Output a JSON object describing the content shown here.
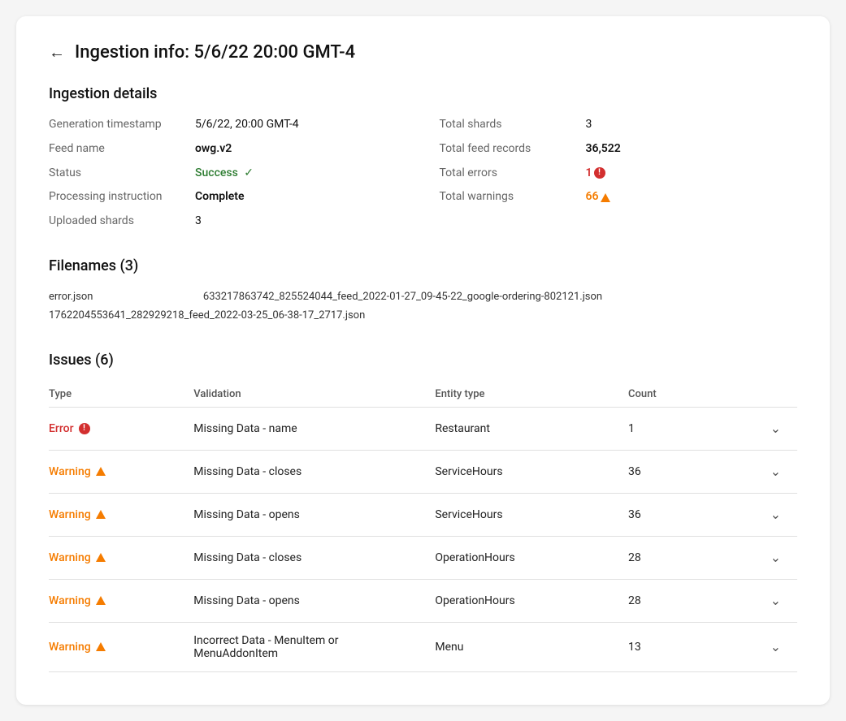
{
  "page": {
    "title": "Ingestion info: 5/6/22 20:00 GMT-4",
    "back_label": "←"
  },
  "ingestion_details": {
    "section_title": "Ingestion details",
    "fields": [
      {
        "label": "Generation timestamp",
        "value": "5/6/22, 20:00 GMT-4",
        "bold": false
      },
      {
        "label": "Feed name",
        "value": "owg.v2",
        "bold": true
      },
      {
        "label": "Status",
        "value": "Success",
        "type": "success"
      },
      {
        "label": "Processing instruction",
        "value": "Complete",
        "bold": true
      },
      {
        "label": "Uploaded shards",
        "value": "3",
        "bold": false
      }
    ],
    "right_fields": [
      {
        "label": "Total shards",
        "value": "3",
        "bold": false
      },
      {
        "label": "Total feed records",
        "value": "36,522",
        "bold": true
      },
      {
        "label": "Total errors",
        "value": "1",
        "type": "error"
      },
      {
        "label": "Total warnings",
        "value": "66",
        "type": "warning"
      }
    ]
  },
  "filenames": {
    "section_title": "Filenames (3)",
    "files": [
      "error.json",
      "633217863742_825524044_feed_2022-01-27_09-45-22_google-ordering-802121.json",
      "1762204553641_282929218_feed_2022-03-25_06-38-17_2717.json"
    ]
  },
  "issues": {
    "section_title": "Issues (6)",
    "columns": [
      "Type",
      "Validation",
      "Entity type",
      "Count"
    ],
    "rows": [
      {
        "type": "Error",
        "type_kind": "error",
        "validation": "Missing Data - name",
        "entity_type": "Restaurant",
        "count": "1"
      },
      {
        "type": "Warning",
        "type_kind": "warning",
        "validation": "Missing Data - closes",
        "entity_type": "ServiceHours",
        "count": "36"
      },
      {
        "type": "Warning",
        "type_kind": "warning",
        "validation": "Missing Data - opens",
        "entity_type": "ServiceHours",
        "count": "36"
      },
      {
        "type": "Warning",
        "type_kind": "warning",
        "validation": "Missing Data - closes",
        "entity_type": "OperationHours",
        "count": "28"
      },
      {
        "type": "Warning",
        "type_kind": "warning",
        "validation": "Missing Data - opens",
        "entity_type": "OperationHours",
        "count": "28"
      },
      {
        "type": "Warning",
        "type_kind": "warning",
        "validation": "Incorrect Data - MenuItem or MenuAddonItem",
        "entity_type": "Menu",
        "count": "13"
      }
    ]
  }
}
